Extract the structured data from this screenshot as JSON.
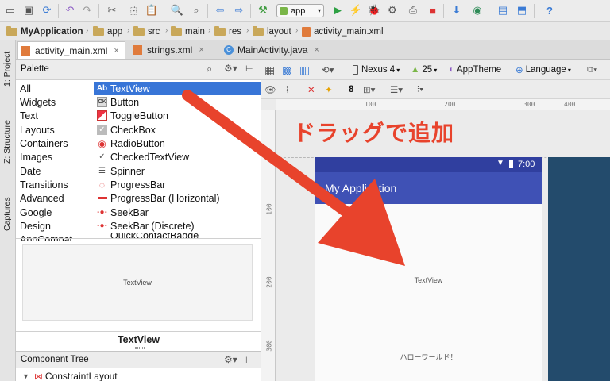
{
  "toolbar": {
    "run_config": "app",
    "icons": [
      "save-icon",
      "sync-icon",
      "undo-icon",
      "redo-icon",
      "cut-icon",
      "copy-icon",
      "paste-icon",
      "find-icon",
      "replace-icon",
      "back-icon",
      "forward-icon",
      "build-icon",
      "run-icon",
      "apply-changes-icon",
      "debug-icon",
      "profile-icon",
      "attach-debugger-icon",
      "stop-icon",
      "sdk-manager-icon",
      "device-manager-icon",
      "sync-gradle-icon",
      "structure-icon",
      "help-icon"
    ]
  },
  "breadcrumbs": [
    "MyApplication",
    "app",
    "src",
    "main",
    "res",
    "layout",
    "activity_main.xml"
  ],
  "tabs": [
    {
      "label": "activity_main.xml",
      "active": true
    },
    {
      "label": "strings.xml",
      "active": false
    },
    {
      "label": "MainActivity.java",
      "active": false
    }
  ],
  "side_tools": [
    "1: Project",
    "Z: Structure",
    "Captures"
  ],
  "palette": {
    "title": "Palette",
    "categories": [
      "All",
      "Widgets",
      "Text",
      "Layouts",
      "Containers",
      "Images",
      "Date",
      "Transitions",
      "Advanced",
      "Google",
      "Design",
      "AppCompat"
    ],
    "items": [
      {
        "label": "TextView",
        "icon": "textview-icon",
        "selected": true
      },
      {
        "label": "Button",
        "icon": "button-icon"
      },
      {
        "label": "ToggleButton",
        "icon": "toggle-icon"
      },
      {
        "label": "CheckBox",
        "icon": "checkbox-icon"
      },
      {
        "label": "RadioButton",
        "icon": "radio-icon"
      },
      {
        "label": "CheckedTextView",
        "icon": "checked-text-icon"
      },
      {
        "label": "Spinner",
        "icon": "spinner-icon"
      },
      {
        "label": "ProgressBar",
        "icon": "progress-icon"
      },
      {
        "label": "ProgressBar (Horizontal)",
        "icon": "progress-horizontal-icon"
      },
      {
        "label": "SeekBar",
        "icon": "seekbar-icon"
      },
      {
        "label": "SeekBar (Discrete)",
        "icon": "seekbar-discrete-icon"
      },
      {
        "label": "QuickContactBadge",
        "icon": "contact-badge-icon"
      }
    ],
    "preview_text": "TextView",
    "preview_label": "TextView"
  },
  "component_tree": {
    "title": "Component Tree",
    "root": "ConstraintLayout"
  },
  "design_toolbar": {
    "device": "Nexus 4",
    "api": "25",
    "theme": "AppTheme",
    "language": "Language",
    "margin": "8"
  },
  "ruler": {
    "top": [
      "100",
      "200",
      "300",
      "400"
    ],
    "left": [
      "100",
      "200",
      "300"
    ]
  },
  "phone": {
    "time": "7:00",
    "app_title": "My Application",
    "dragged_text": "TextView",
    "hello_text": "ハローワールド！",
    "status_color": "#303f9f",
    "appbar_color": "#3f51b5"
  },
  "annotation": {
    "text": "ドラッグで追加",
    "color": "#e8432c"
  }
}
